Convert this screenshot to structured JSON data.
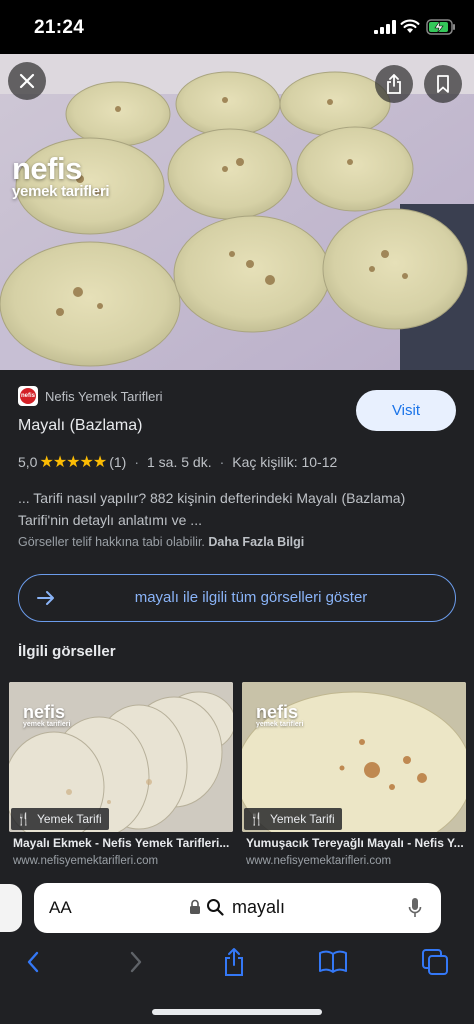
{
  "status_bar": {
    "time": "21:24",
    "icons": [
      "signal-icon",
      "wifi-icon",
      "battery-charging-icon"
    ]
  },
  "hero": {
    "brand_main": "nefis",
    "brand_sub": "yemek tarifleri",
    "buttons": [
      "close-icon",
      "share-icon",
      "bookmark-icon"
    ]
  },
  "result": {
    "source_name": "Nefis Yemek Tarifleri",
    "favicon_text": "nefis",
    "visit_label": "Visit",
    "title": "Mayalı (Bazlama)",
    "rating_value": "5,0",
    "stars": "★★★★★",
    "rating_count": "(1)",
    "duration": "1 sa. 5 dk.",
    "servings": "Kaç kişilik: 10-12",
    "description": "... Tarifi nasıl yapılır? 882 kişinin defterindeki Mayalı (Bazlama) Tarifi'nin detaylı anlatımı ve ...",
    "copyright_text": "Görseller telif hakkına tabi olabilir.",
    "more_info": "Daha Fazla Bilgi",
    "show_all_label": "mayalı ile ilgili tüm görselleri göster"
  },
  "related": {
    "title": "İlgili görseller",
    "items": [
      {
        "logo_main": "nefis",
        "logo_sub": "yemek tarifleri",
        "badge": "Yemek Tarifi",
        "caption": "Mayalı Ekmek - Nefis Yemek Tarifleri...",
        "url": "www.nefisyemektarifleri.com"
      },
      {
        "logo_main": "nefis",
        "logo_sub": "yemek tarifleri",
        "badge": "Yemek Tarifi",
        "caption": "Yumuşacık Tereyağlı Mayalı - Nefis Y...",
        "url": "www.nefisyemektarifleri.com"
      }
    ]
  },
  "safari": {
    "aa_label": "AA",
    "address_text": "mayalı",
    "toolbar_icons": [
      "back-icon",
      "forward-icon",
      "share-icon",
      "bookmarks-icon",
      "tabs-icon"
    ]
  },
  "colors": {
    "panel_bg": "#202124",
    "link_blue": "#8ab4f8",
    "star_yellow": "#fbbc04",
    "visit_bg": "#e8f0fe"
  }
}
